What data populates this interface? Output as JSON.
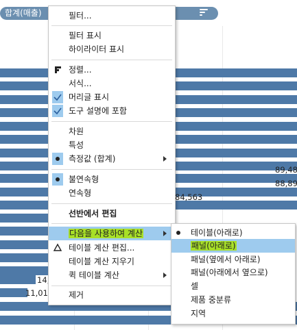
{
  "field_pill": {
    "label": "합계(매출)"
  },
  "chart": {
    "bar_color": "#4e79a7",
    "labels": {
      "a": "89,48",
      "b": "88,89",
      "c": "84,563",
      "d": "14,",
      "e": "11,01"
    }
  },
  "menu": {
    "filter": "필터...",
    "show_filter": "필터 표시",
    "show_highlighter": "하이라이터 표시",
    "sort": "정렬...",
    "format": "서식...",
    "show_header": "머리글 표시",
    "include_in_tooltip": "도구 설명에 포함",
    "dimension": "차원",
    "attribute": "특성",
    "measure": "측정값 (합계)",
    "discrete": "불연속형",
    "continuous": "연속형",
    "edit_in_shelf": "선반에서 편집",
    "compute_using": "다음을 사용하여 계산",
    "edit_table_calc": "테이블 계산 편집...",
    "clear_table_calc": "테이블 계산 지우기",
    "quick_table_calc": "퀵 테이블 계산",
    "remove": "제거"
  },
  "submenu": {
    "table_down": "테이블(아래로)",
    "pane_down": "패널(아래로)",
    "pane_across_then_down": "패널(옆에서 아래로)",
    "pane_down_then_across": "패널(아래에서 옆으로)",
    "cell": "셀",
    "product_subcategory": "제품 중분류",
    "region": "지역"
  },
  "colors": {
    "highlight": "#9ecbee",
    "annotation": "#a8e028",
    "pill": "#6b8fb0"
  }
}
